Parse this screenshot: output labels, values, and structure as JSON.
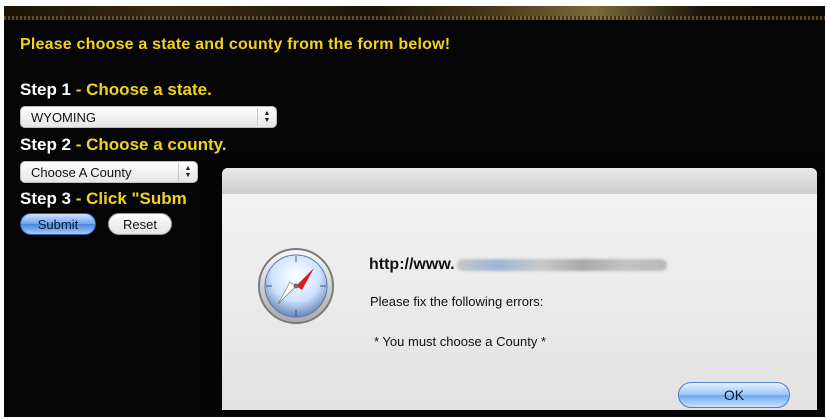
{
  "page": {
    "headline": "Please choose a state and county from the form below!",
    "step1": {
      "label": "Step 1",
      "text": " - Choose a state."
    },
    "step2": {
      "label": "Step 2",
      "text": " - Choose a county."
    },
    "step3": {
      "label": "Step 3",
      "text": " - Click \"Subm"
    },
    "state_select": {
      "value": "WYOMING"
    },
    "county_select": {
      "value": "Choose A County"
    },
    "buttons": {
      "submit": "Submit",
      "reset": "Reset"
    }
  },
  "alert": {
    "url_prefix": "http://www.",
    "message_line1": "Please fix the following errors:",
    "message_line2": "* You must choose a County *",
    "ok_label": "OK",
    "icon": "safari-compass-icon"
  },
  "colors": {
    "background": "#050505",
    "accent": "#f2d21f",
    "primary_button": "#6ea8ef"
  }
}
